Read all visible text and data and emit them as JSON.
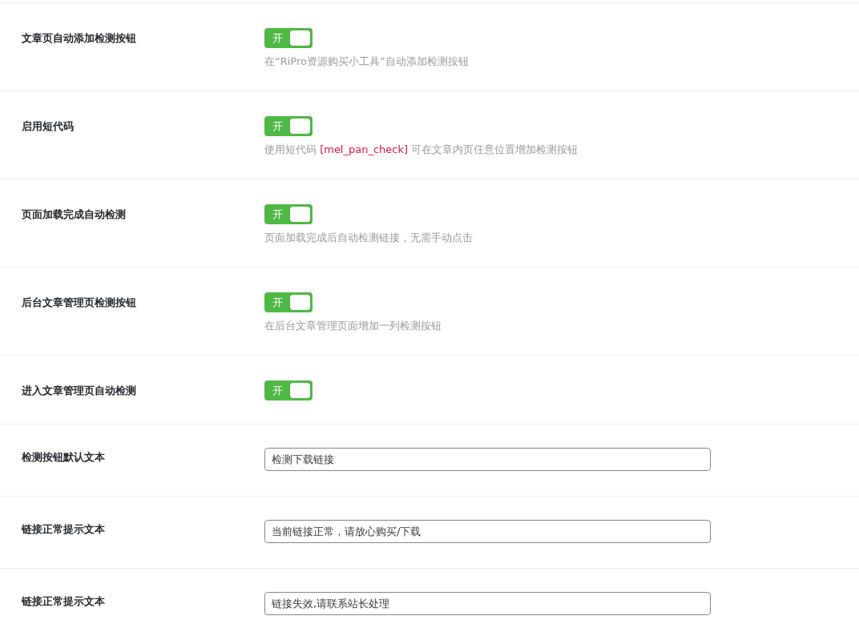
{
  "settings": [
    {
      "kind": "switch",
      "label": "文章页自动添加检测按钮",
      "on": true,
      "switch_text": "开",
      "description": [
        {
          "kind": "text",
          "text": "在“RiPro资源购买小工具”自动添加检测按钮"
        }
      ]
    },
    {
      "kind": "switch",
      "label": "启用短代码",
      "on": true,
      "switch_text": "开",
      "description": [
        {
          "kind": "text",
          "text": "使用短代码 "
        },
        {
          "kind": "code",
          "text": "[mel_pan_check]"
        },
        {
          "kind": "text",
          "text": " 可在文章内页任意位置增加检测按钮"
        }
      ]
    },
    {
      "kind": "switch",
      "label": "页面加载完成自动检测",
      "on": true,
      "switch_text": "开",
      "description": [
        {
          "kind": "text",
          "text": "页面加载完成后自动检测链接，无需手动点击"
        }
      ]
    },
    {
      "kind": "switch",
      "label": "后台文章管理页检测按钮",
      "on": true,
      "switch_text": "开",
      "description": [
        {
          "kind": "text",
          "text": "在后台文章管理页面增加一列检测按钮"
        }
      ]
    },
    {
      "kind": "switch",
      "label": "进入文章管理页自动检测",
      "on": true,
      "switch_text": "开"
    },
    {
      "kind": "text",
      "label": "检测按钮默认文本",
      "value": "检测下载链接"
    },
    {
      "kind": "text",
      "label": "链接正常提示文本",
      "value": "当前链接正常，请放心购买/下载"
    },
    {
      "kind": "text",
      "label": "链接正常提示文本",
      "value": "链接失效,请联系站长处理"
    }
  ]
}
